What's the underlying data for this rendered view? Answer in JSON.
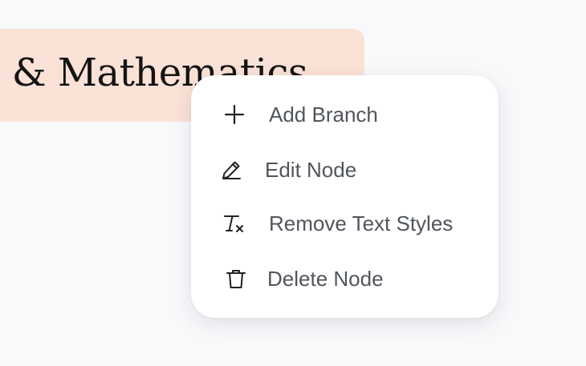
{
  "node": {
    "text": "cs & Mathematics",
    "background_color": "#fbe2d6"
  },
  "context_menu": {
    "items": [
      {
        "label": "Add Branch",
        "icon": "plus-icon"
      },
      {
        "label": "Edit Node",
        "icon": "pencil-icon"
      },
      {
        "label": "Remove Text Styles",
        "icon": "remove-text-styles-icon"
      },
      {
        "label": "Delete Node",
        "icon": "trash-icon"
      }
    ],
    "text_color": "#50555c",
    "icon_color": "#1f2328"
  }
}
